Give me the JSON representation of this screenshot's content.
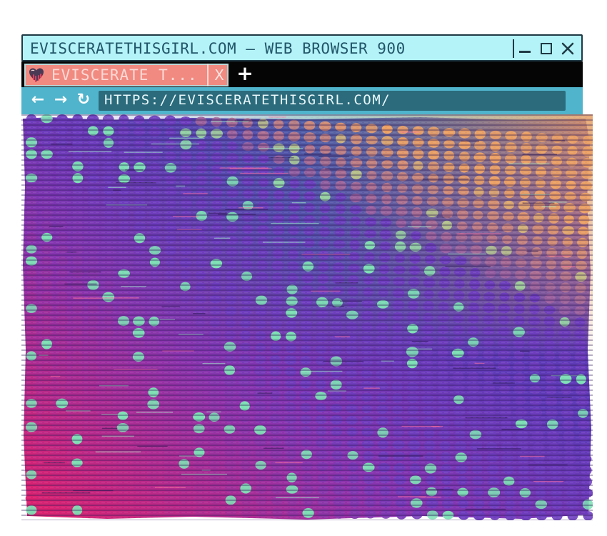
{
  "window": {
    "title": "EVISCERATETHISGIRL.COM — WEB BROWSER 900"
  },
  "tabs": [
    {
      "label": "EVISCERATE T...",
      "favicon": "bleeding-heart-icon",
      "close": "X"
    }
  ],
  "newtab": {
    "label": "+"
  },
  "nav": {
    "back": "←",
    "forward": "→",
    "reload": "↻"
  },
  "address": {
    "url": "HTTPS://EVISCERATETHISGIRL.COM/"
  },
  "colors": {
    "titlebar_bg": "#b4f3f7",
    "title_text": "#22566a",
    "tabbar_bg": "#050505",
    "tab_bg": "#f18a80",
    "navbar_bg": "#4fb4cc",
    "address_bg": "#2b6b7c",
    "content_purple": "#6a3bb5",
    "content_magenta": "#e5206a",
    "content_orange": "#e8a060",
    "dot_green": "#7de0b5"
  },
  "icons": {
    "favicon": "bleeding-heart-icon",
    "minimize": "minimize-icon",
    "maximize": "maximize-icon",
    "close": "close-icon"
  }
}
